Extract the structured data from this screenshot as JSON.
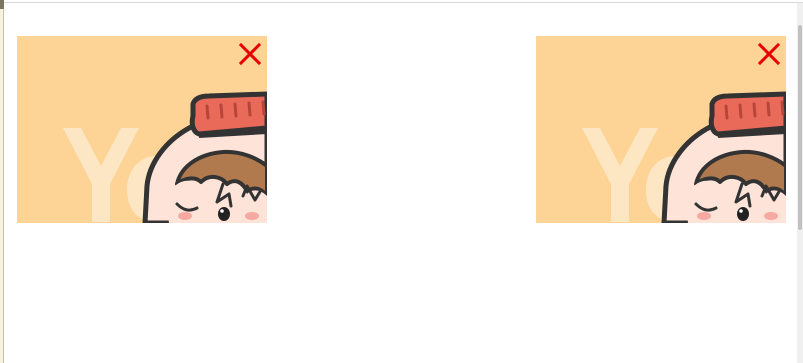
{
  "ads": [
    {
      "id": "ad-left",
      "close_icon": "close-icon",
      "background_color": "#fdd396",
      "close_color": "#e60000"
    },
    {
      "id": "ad-right",
      "close_icon": "close-icon",
      "background_color": "#fdd396",
      "close_color": "#e60000"
    }
  ],
  "artwork": {
    "logo_text": "Ya",
    "description_icon": "cartoon-character-icon"
  },
  "colors": {
    "page_background": "#ffffff",
    "ad_background": "#fdd396",
    "hat": "#ea6a5a",
    "skin": "#fde3d8",
    "hair": "#b07a4e",
    "outline": "#333333",
    "close": "#e60000"
  }
}
